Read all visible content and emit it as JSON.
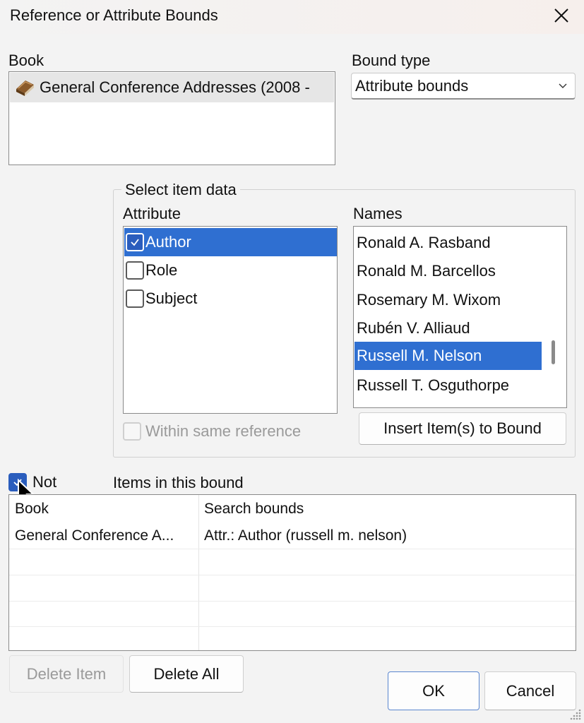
{
  "window": {
    "title": "Reference or Attribute Bounds"
  },
  "book": {
    "label": "Book",
    "items": [
      {
        "name": "General Conference Addresses (2008 -",
        "icon": "book-icon"
      }
    ]
  },
  "bound_type": {
    "label": "Bound type",
    "value": "Attribute bounds"
  },
  "select_item_data": {
    "legend": "Select item data",
    "attribute_label": "Attribute",
    "attributes": [
      {
        "label": "Author",
        "checked": true,
        "selected": true
      },
      {
        "label": "Role",
        "checked": false,
        "selected": false
      },
      {
        "label": "Subject",
        "checked": false,
        "selected": false
      }
    ],
    "names_label": "Names",
    "names": [
      {
        "label": "Ronald A. Rasband",
        "selected": false
      },
      {
        "label": "Ronald M. Barcellos",
        "selected": false
      },
      {
        "label": "Rosemary M. Wixom",
        "selected": false
      },
      {
        "label": "Rubén V. Alliaud",
        "selected": false
      },
      {
        "label": "Russell M. Nelson",
        "selected": true
      },
      {
        "label": "Russell T. Osguthorpe",
        "selected": false
      }
    ],
    "within_same_reference": {
      "label": "Within same reference",
      "checked": false,
      "enabled": false
    },
    "insert_button": "Insert Item(s) to Bound"
  },
  "not_checkbox": {
    "label": "Not",
    "checked": true
  },
  "items_in_bound": {
    "label": "Items in this bound",
    "columns": [
      "Book",
      "Search bounds"
    ],
    "rows": [
      [
        "General Conference A...",
        "Attr.: Author (russell m. nelson)"
      ]
    ]
  },
  "buttons": {
    "delete_item": "Delete Item",
    "delete_all": "Delete All",
    "ok": "OK",
    "cancel": "Cancel"
  },
  "colors": {
    "selection": "#2f6fd1",
    "checkbox_checked": "#2a5dbd"
  }
}
